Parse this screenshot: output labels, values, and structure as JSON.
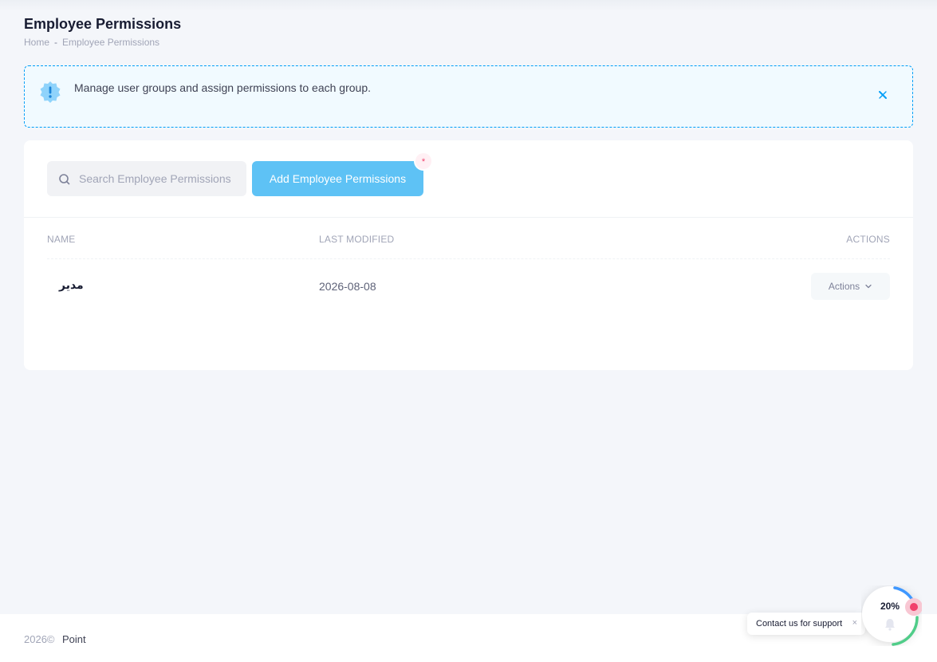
{
  "page": {
    "title": "Employee Permissions",
    "breadcrumb": {
      "home": "Home",
      "separator": "-",
      "current": "Employee Permissions"
    }
  },
  "notice": {
    "text": "Manage user groups and assign permissions to each group.",
    "icon": "exclamation-badge-icon",
    "close_icon": "close-icon"
  },
  "toolbar": {
    "search_placeholder": "Search Employee Permissions",
    "search_value": "",
    "add_button": "Add Employee Permissions",
    "add_badge": "*"
  },
  "table": {
    "columns": [
      "NAME",
      "LAST MODIFIED",
      "ACTIONS"
    ],
    "rows": [
      {
        "name": "مدير",
        "last_modified": "2026-08-08",
        "actions_label": "Actions"
      }
    ]
  },
  "footer": {
    "year": "2026©",
    "brand": "Point"
  },
  "support_widget": {
    "label": "Contact us for support",
    "close": "×",
    "progress_label": "20%",
    "progress": 0.2
  },
  "colors": {
    "accent": "#009ef7",
    "add_button": "#5ec2f5",
    "notice_bg": "#f1faff",
    "danger": "#f1416c",
    "success": "#50cd89"
  }
}
